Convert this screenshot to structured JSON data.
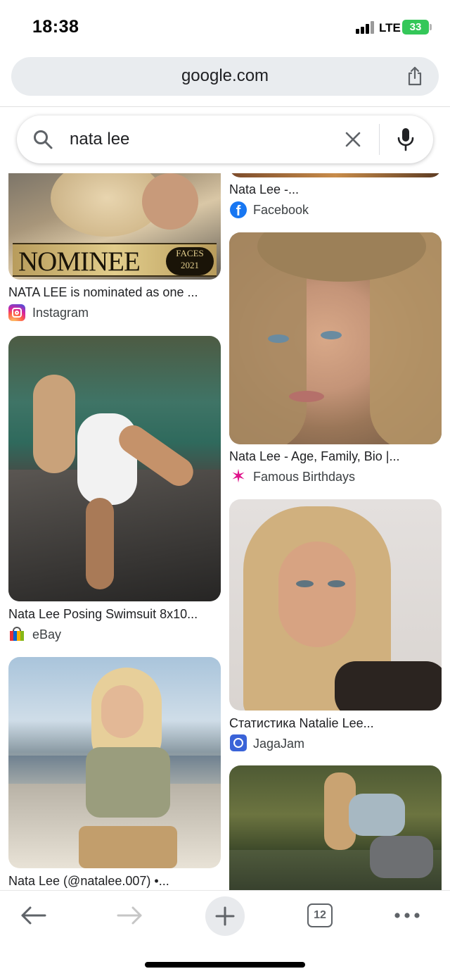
{
  "status": {
    "time": "18:38",
    "network": "LTE",
    "battery": "33"
  },
  "browser": {
    "url": "google.com",
    "tab_count": "12"
  },
  "search": {
    "query": "nata lee"
  },
  "results": {
    "left": [
      {
        "overlay_text": "NOMINEE",
        "badge_line1": "FACES",
        "badge_line2": "2021",
        "title": "NATA LEE is nominated as one ...",
        "source": "Instagram"
      },
      {
        "title": "Nata Lee Posing Swimsuit 8x10...",
        "source": "eBay"
      },
      {
        "title": "Nata Lee (@natalee.007) •...",
        "source": ""
      }
    ],
    "right": [
      {
        "title": "Nata Lee -...",
        "source": "Facebook"
      },
      {
        "title": "Nata Lee - Age, Family, Bio |...",
        "source": "Famous Birthdays"
      },
      {
        "title": "Статистика Natalie Lee...",
        "source": "JagaJam"
      },
      {
        "title": "",
        "source": ""
      }
    ]
  },
  "colors": {
    "url_bar_bg": "#e9ecef",
    "battery": "#34c759",
    "text": "#202124"
  },
  "icons": [
    "signal-icon",
    "share-icon",
    "search-icon",
    "clear-icon",
    "mic-icon",
    "instagram-icon",
    "facebook-icon",
    "ebay-icon",
    "famous-birthdays-icon",
    "jagajam-icon",
    "back-icon",
    "forward-icon",
    "new-tab-icon",
    "tabs-icon",
    "more-icon"
  ]
}
